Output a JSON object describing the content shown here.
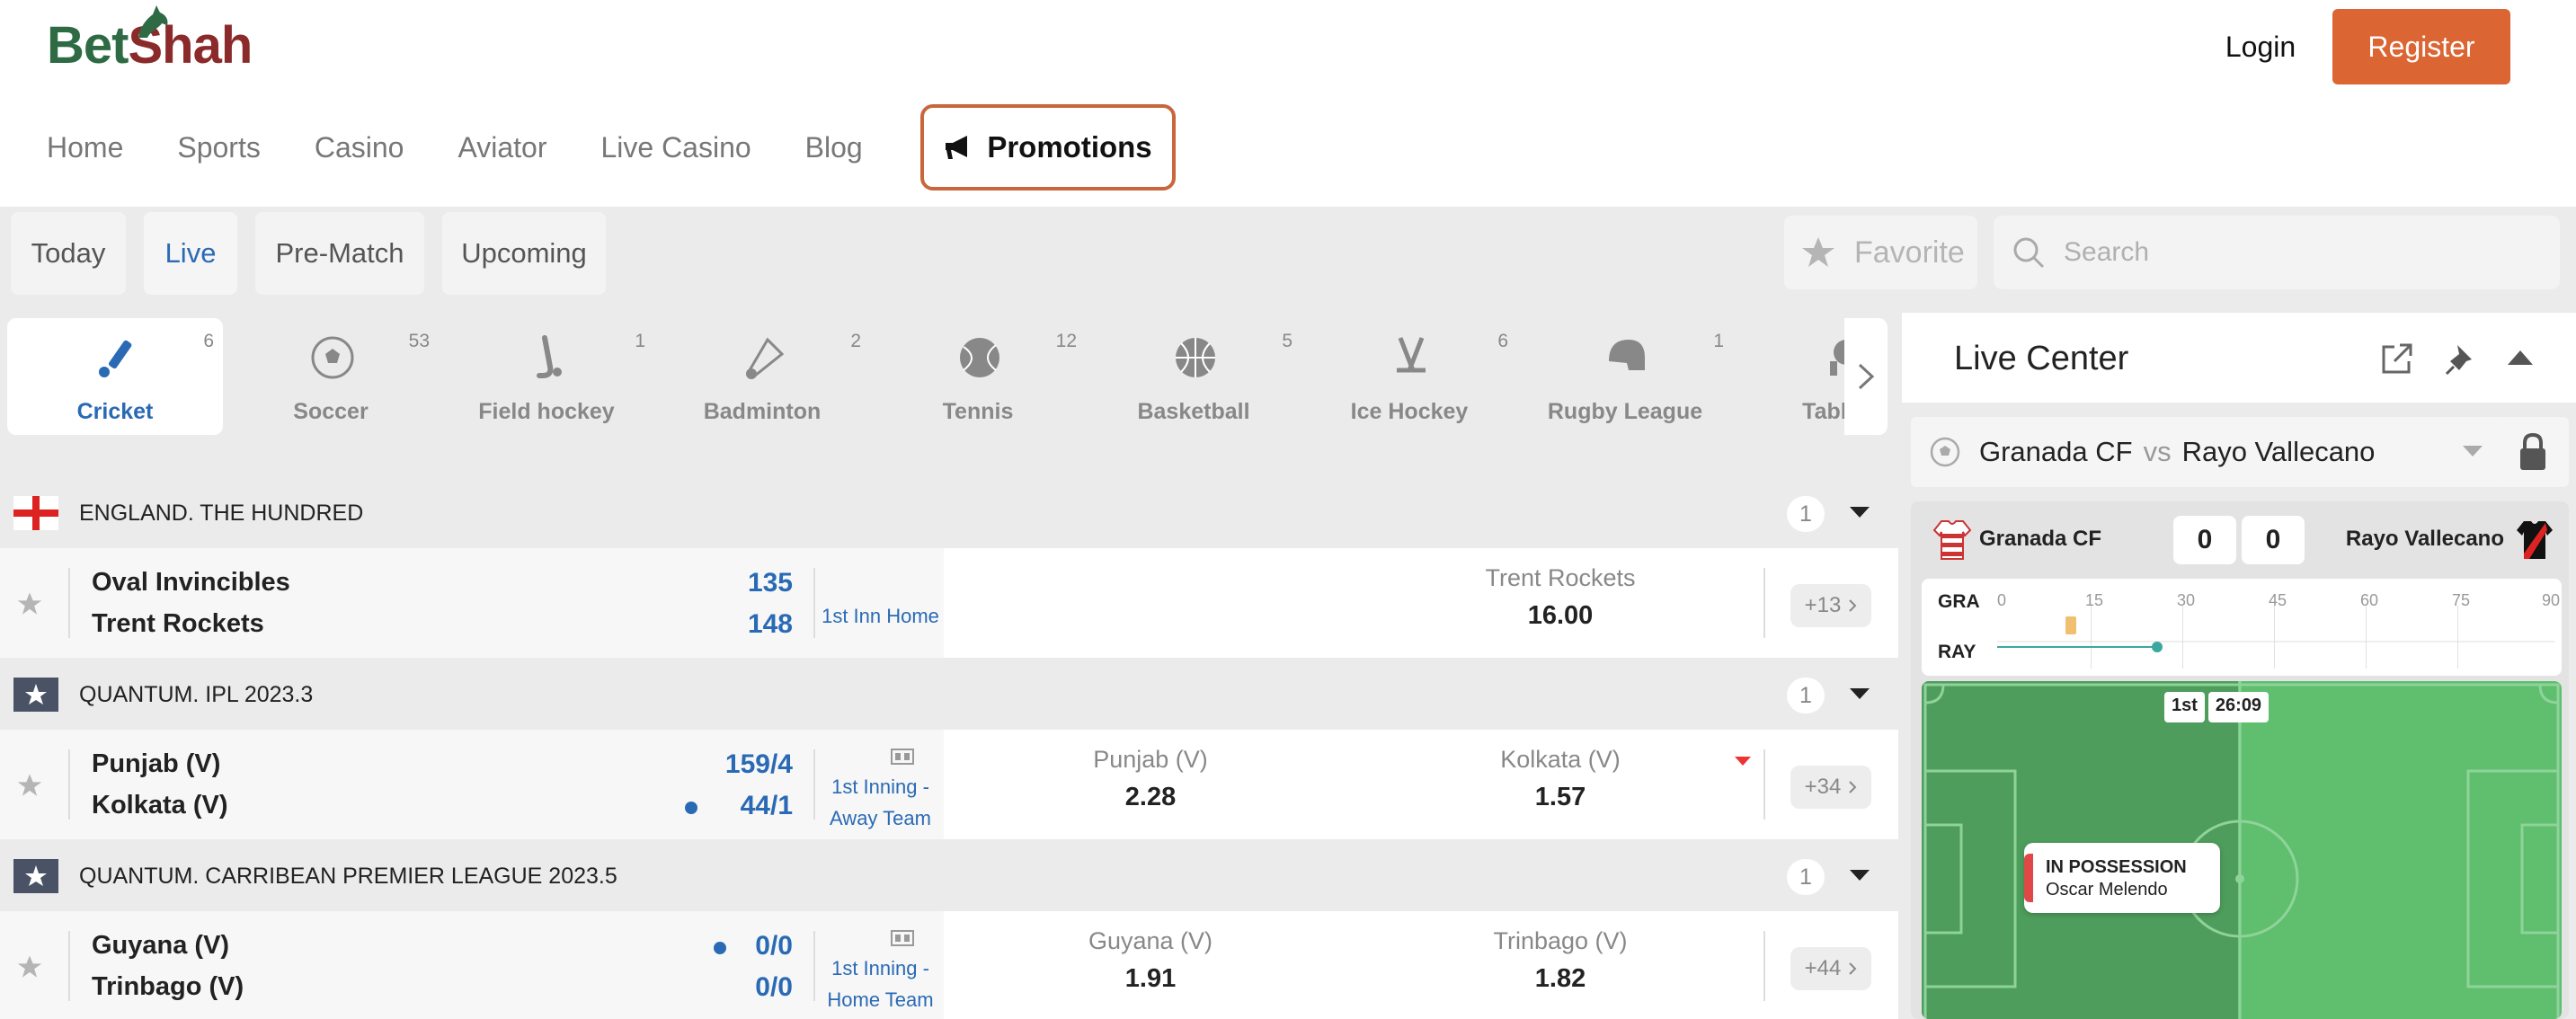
{
  "brand": {
    "bet": "Bet",
    "shah": "Shah"
  },
  "auth": {
    "login": "Login",
    "register": "Register"
  },
  "nav": {
    "items": [
      "Home",
      "Sports",
      "Casino",
      "Aviator",
      "Live Casino",
      "Blog"
    ],
    "promotions": "Promotions"
  },
  "filters": {
    "tabs": [
      "Today",
      "Live",
      "Pre-Match",
      "Upcoming"
    ],
    "active": "Live",
    "favorite": "Favorite",
    "search_placeholder": "Search"
  },
  "sports": [
    {
      "label": "Cricket",
      "count": "6",
      "icon": "cricket-icon"
    },
    {
      "label": "Soccer",
      "count": "53",
      "icon": "soccer-ball-icon"
    },
    {
      "label": "Field hockey",
      "count": "1",
      "icon": "field-hockey-icon"
    },
    {
      "label": "Badminton",
      "count": "2",
      "icon": "shuttlecock-icon"
    },
    {
      "label": "Tennis",
      "count": "12",
      "icon": "tennis-ball-icon"
    },
    {
      "label": "Basketball",
      "count": "5",
      "icon": "basketball-icon"
    },
    {
      "label": "Ice Hockey",
      "count": "6",
      "icon": "ice-hockey-icon"
    },
    {
      "label": "Rugby League",
      "count": "1",
      "icon": "rugby-helmet-icon"
    },
    {
      "label": "Table T",
      "count": "",
      "icon": "table-tennis-icon"
    }
  ],
  "leagues": [
    {
      "name": "ENGLAND. THE HUNDRED",
      "count": "1",
      "match": {
        "team1": "Oval Invincibles",
        "team2": "Trent Rockets",
        "score1": "135",
        "score2": "148",
        "period": "1st Inn Home",
        "odds": [
          {
            "name": "Trent Rockets",
            "value": "16.00"
          }
        ],
        "more": "+13"
      }
    },
    {
      "name": "QUANTUM. IPL 2023.3",
      "count": "1",
      "match": {
        "team1": "Punjab (V)",
        "team2": "Kolkata (V)",
        "score1": "159/4",
        "score2": "44/1",
        "period_line1": "1st Inning -",
        "period_line2": "Away Team",
        "odds": [
          {
            "name": "Punjab (V)",
            "value": "2.28"
          },
          {
            "name": "Kolkata (V)",
            "value": "1.57"
          }
        ],
        "more": "+34"
      }
    },
    {
      "name": "QUANTUM. CARRIBEAN PREMIER LEAGUE 2023.5",
      "count": "1",
      "match": {
        "team1": "Guyana (V)",
        "team2": "Trinbago (V)",
        "score1": "0/0",
        "score2": "0/0",
        "period_line1": "1st Inning -",
        "period_line2": "Home Team",
        "odds": [
          {
            "name": "Guyana (V)",
            "value": "1.91"
          },
          {
            "name": "Trinbago (V)",
            "value": "1.82"
          }
        ],
        "more": "+44"
      }
    }
  ],
  "live_center": {
    "title": "Live Center",
    "selected_team1": "Granada CF",
    "vs": "vs",
    "selected_team2": "Rayo Vallecano",
    "scoreboard": {
      "team1": "Granada CF",
      "team2": "Rayo Vallecano",
      "score1": "0",
      "score2": "0",
      "timeline_labels": [
        "GRA",
        "RAY"
      ],
      "ticks": [
        "0",
        "15",
        "30",
        "45",
        "60",
        "75",
        "90"
      ],
      "period": "1st",
      "clock": "26:09",
      "possession_label": "IN POSSESSION",
      "possession_player": "Oscar Melendo"
    }
  },
  "colors": {
    "accent": "#db6533",
    "link_blue": "#2a6ab5",
    "brand_green": "#2e6b45",
    "brand_red": "#8b2a2a",
    "pitch_green": "#5fbf6e"
  }
}
